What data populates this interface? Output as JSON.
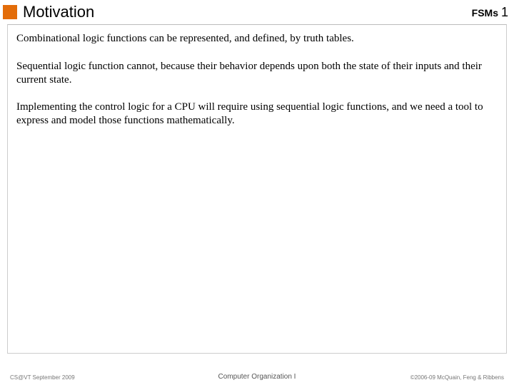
{
  "header": {
    "title": "Motivation",
    "topic": "FSMs",
    "page": "1"
  },
  "body": {
    "p1": "Combinational logic functions can be represented, and defined, by truth tables.",
    "p2": "Sequential logic function cannot, because their behavior depends upon both the state of their inputs and their current state.",
    "p3": "Implementing the control logic for a CPU will require using sequential logic functions, and we need a tool to express and model those functions mathematically."
  },
  "footer": {
    "left": "CS@VT September 2009",
    "center": "Computer Organization I",
    "right": "©2006-09  McQuain, Feng & Ribbens"
  }
}
